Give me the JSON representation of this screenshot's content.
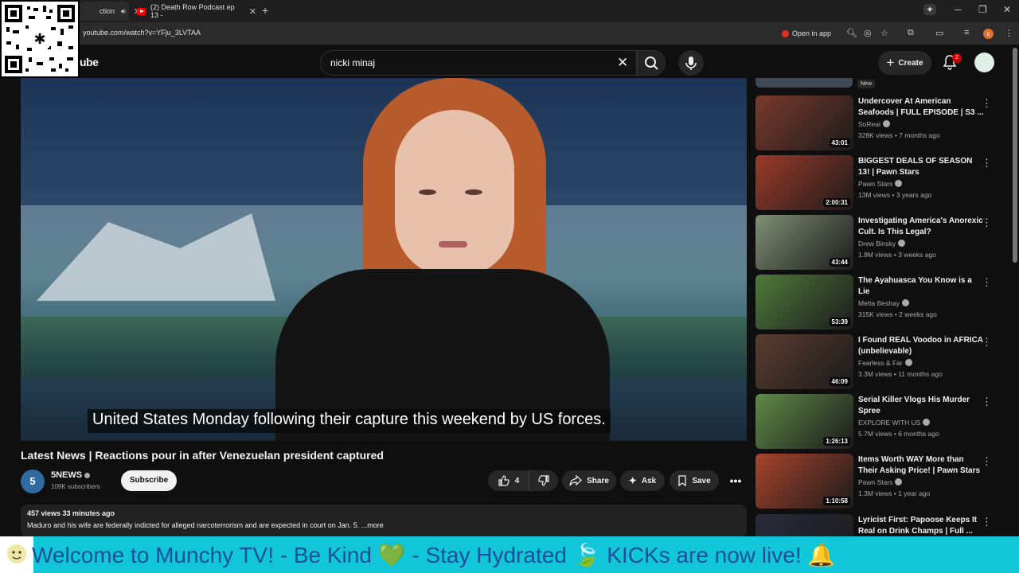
{
  "browser": {
    "tabs": [
      {
        "label": "ction"
      },
      {
        "label": "(2) Death Row Podcast ep 13 -"
      }
    ],
    "new_tab": "+",
    "url": "youtube.com/watch?v=YFju_3LVTAA",
    "open_in_app": "Open in app",
    "profile_initial": "c"
  },
  "youtube": {
    "logo_fragment": "ube",
    "search_value": "nicki minaj",
    "create_label": "Create",
    "notification_count": "2"
  },
  "video": {
    "caption": "United States Monday following their capture this weekend by US forces.",
    "title": "Latest News | Reactions pour in after Venezuelan president captured",
    "channel": {
      "logo_text": "5",
      "name": "5NEWS",
      "subscribers": "109K subscribers"
    },
    "subscribe_label": "Subscribe",
    "likes": "4",
    "share_label": "Share",
    "ask_label": "Ask",
    "save_label": "Save",
    "description": {
      "meta": "457 views  33 minutes ago",
      "text": "Maduro and his wife are federally indicted for alleged narcoterrorism and are expected in court on Jan. 5. ...more"
    }
  },
  "sidebar": {
    "new_badge": "New",
    "items": [
      {
        "title": "Undercover At American Seafoods | FULL EPISODE | S3 ...",
        "channel": "SoReal",
        "verified": true,
        "meta": "328K views • 7 months ago",
        "duration": "43:01",
        "thumb_color": "#7a3a2c"
      },
      {
        "title": "BIGGEST DEALS OF SEASON 13! | Pawn Stars",
        "channel": "Pawn Stars",
        "verified": true,
        "meta": "13M views • 3 years ago",
        "duration": "2:00:31",
        "thumb_color": "#9c3a2a"
      },
      {
        "title": "Investigating America's Anorexic Cult. Is This Legal?",
        "channel": "Drew Binsky",
        "verified": true,
        "meta": "1.8M views • 3 weeks ago",
        "duration": "43:44",
        "thumb_color": "#7f8f74"
      },
      {
        "title": "The Ayahuasca You Know is a Lie",
        "channel": "Metta Beshay",
        "verified": true,
        "meta": "315K views • 2 weeks ago",
        "duration": "53:39",
        "thumb_color": "#4f7a3c"
      },
      {
        "title": "I Found REAL Voodoo in AFRICA (unbelievable)",
        "channel": "Fearless & Far",
        "verified": true,
        "meta": "3.3M views • 11 months ago",
        "duration": "46:09",
        "thumb_color": "#5a3c30"
      },
      {
        "title": "Serial Killer Vlogs His Murder Spree",
        "channel": "EXPLORE WITH US",
        "verified": true,
        "meta": "5.7M views • 6 months ago",
        "duration": "1:26:13",
        "thumb_color": "#5f8a48"
      },
      {
        "title": "Items Worth WAY More than Their Asking Price! | Pawn Stars",
        "channel": "Pawn Stars",
        "verified": true,
        "meta": "1.3M views • 1 year ago",
        "duration": "1:10:58",
        "thumb_color": "#a8442c"
      },
      {
        "title": "Lyricist First: Papoose Keeps It Real on Drink Champs | Full ...",
        "channel": "",
        "verified": false,
        "meta": "",
        "duration": "",
        "thumb_color": "#2a2a3a"
      }
    ]
  },
  "ticker": {
    "text": "Welcome to Munchy TV!  - Be Kind 💚  - Stay Hydrated 🍃  KICKs are now live! 🔔"
  },
  "colors": {
    "accent_red": "#ff0000",
    "ticker_bg": "#12c6d9",
    "ticker_text": "#1a4f9a"
  }
}
